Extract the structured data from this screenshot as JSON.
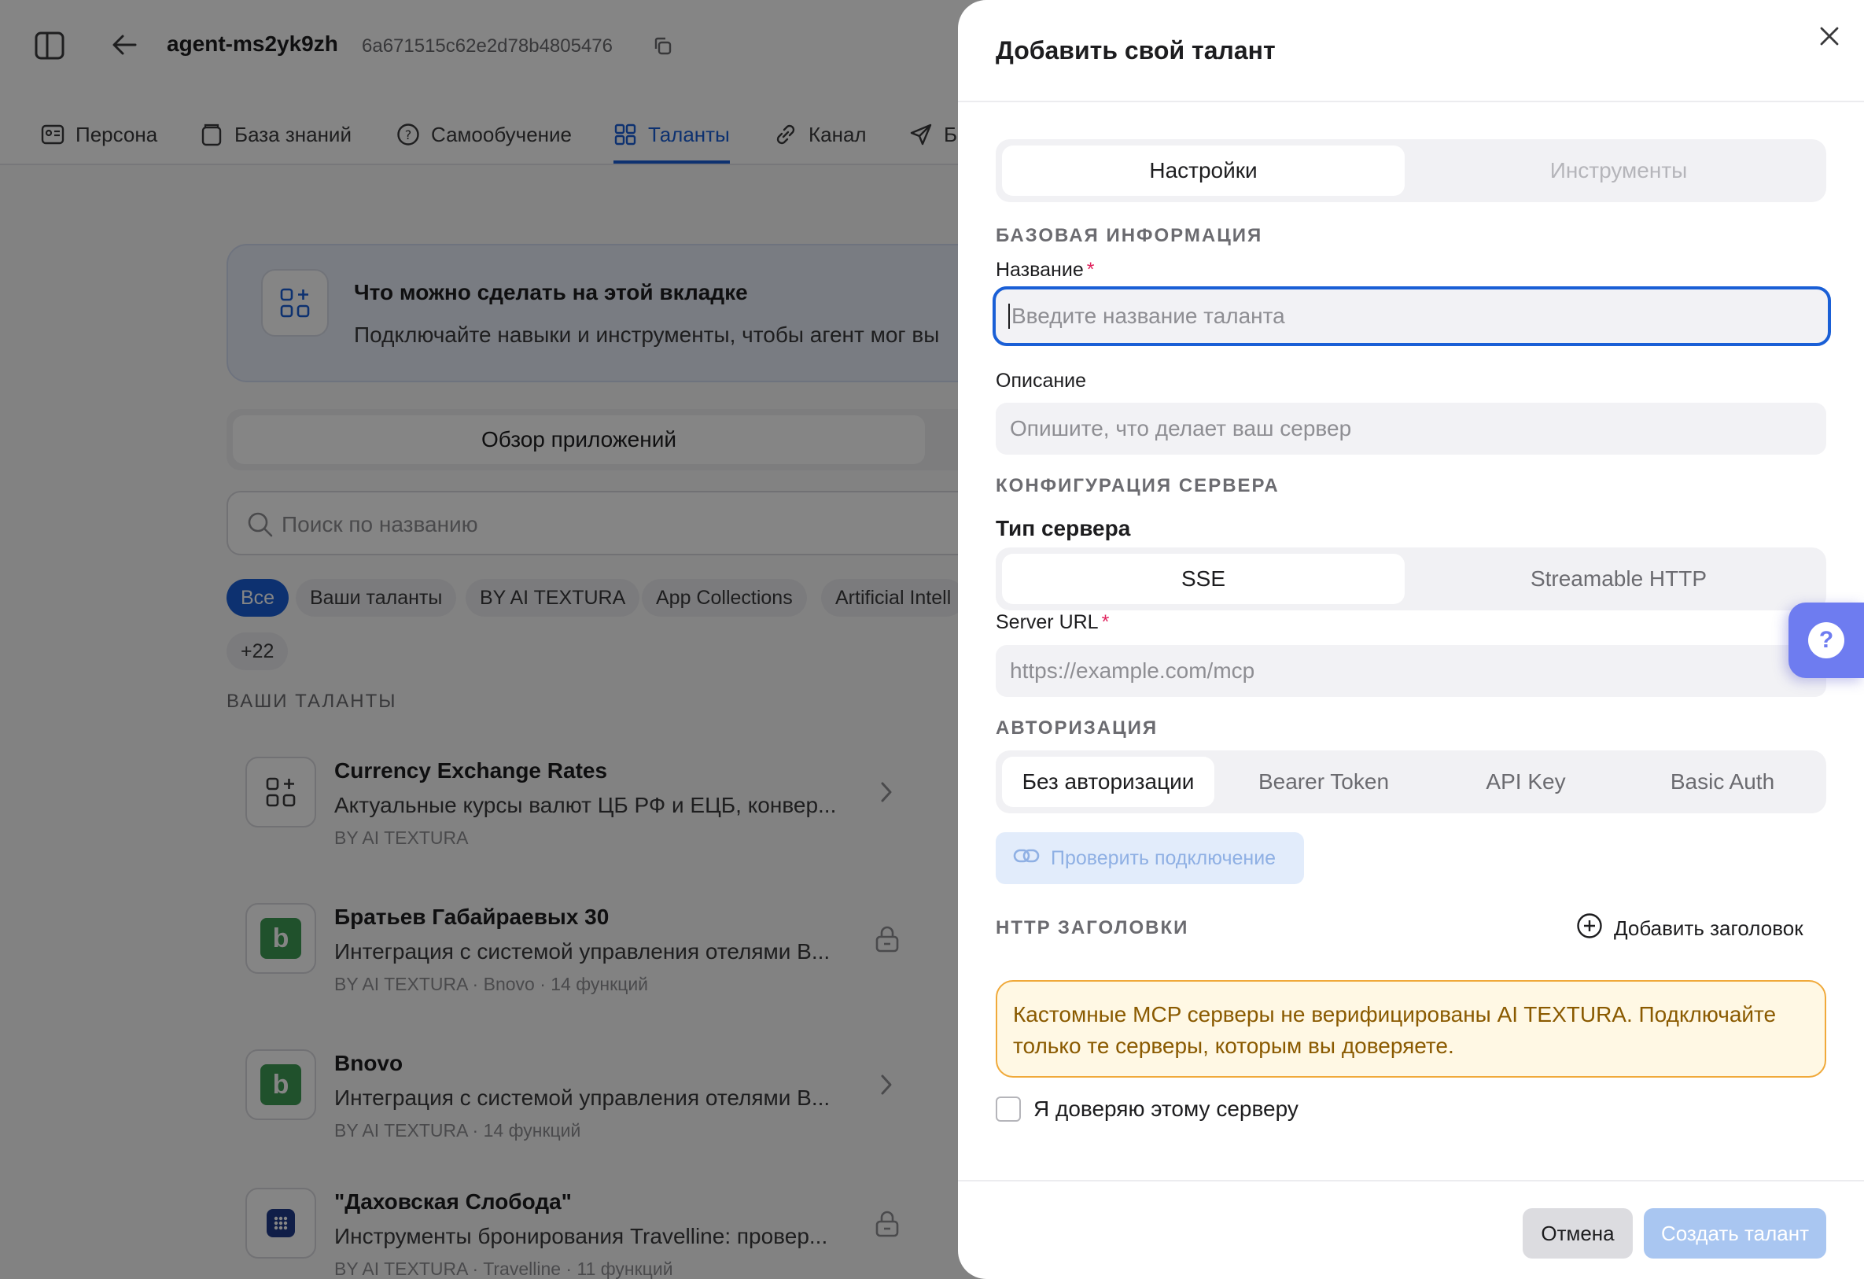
{
  "topbar": {
    "agent_name": "agent-ms2yk9zh",
    "agent_id": "6a671515c62e2d78b4805476"
  },
  "tabs": [
    {
      "label": "Персона",
      "icon": "persona-icon"
    },
    {
      "label": "База знаний",
      "icon": "database-icon"
    },
    {
      "label": "Самообучение",
      "icon": "question-circle-icon"
    },
    {
      "label": "Таланты",
      "icon": "grid-icon",
      "active": true
    },
    {
      "label": "Канал",
      "icon": "link-icon"
    },
    {
      "label": "Б",
      "icon": "send-icon"
    }
  ],
  "info_card": {
    "title": "Что можно сделать на этой вкладке",
    "text": "Подключайте навыки и инструменты, чтобы агент мог вы"
  },
  "segment": {
    "active_label": "Обзор приложений"
  },
  "search": {
    "placeholder": "Поиск по названию"
  },
  "chips": [
    "Все",
    "Ваши таланты",
    "BY AI TEXTURA",
    "App Collections",
    "Artificial Intell",
    "+22"
  ],
  "section_label": "ВАШИ ТАЛАНТЫ",
  "talents": [
    {
      "title": "Currency Exchange Rates",
      "desc": "Актуальные курсы валют ЦБ РФ и ЕЦБ, конвер...",
      "meta": "BY AI TEXTURA",
      "icon": "grid-plus-icon",
      "side": "chevron-right-icon"
    },
    {
      "title": "Братьев Габайраевых 30",
      "desc": "Интеграция с системой управления отелями B...",
      "meta": "BY AI TEXTURA · Bnovo · 14 функций",
      "icon": "bnovo-logo",
      "side": "lock-icon"
    },
    {
      "title": "Bnovo",
      "desc": "Интеграция с системой управления отелями B...",
      "meta": "BY AI TEXTURA · 14 функций",
      "icon": "bnovo-logo",
      "side": "chevron-right-icon"
    },
    {
      "title": "\"Даховская Слобода\"",
      "desc": "Инструменты бронирования Travelline: провер...",
      "meta": "BY AI TEXTURA · Travelline · 11 функций",
      "icon": "travelline-logo",
      "side": "lock-icon"
    }
  ],
  "drawer": {
    "title": "Добавить свой талант",
    "tabs": {
      "settings": "Настройки",
      "tools": "Инструменты"
    },
    "basic_info_caption": "БАЗОВАЯ ИНФОРМАЦИЯ",
    "name_label": "Название",
    "name_placeholder": "Введите название таланта",
    "desc_label": "Описание",
    "desc_placeholder": "Опишите, что делает ваш сервер",
    "server_config_caption": "КОНФИГУРАЦИЯ СЕРВЕРА",
    "server_type_label": "Тип сервера",
    "server_types": [
      "SSE",
      "Streamable HTTP"
    ],
    "server_url_label": "Server URL",
    "server_url_placeholder": "https://example.com/mcp",
    "auth_caption": "АВТОРИЗАЦИЯ",
    "auth_options": [
      "Без авторизации",
      "Bearer Token",
      "API Key",
      "Basic Auth"
    ],
    "check_connection": "Проверить подключение",
    "http_headers_caption": "HTTP ЗАГОЛОВКИ",
    "add_header": "Добавить заголовок",
    "warning": "Кастомные MCP серверы не верифицированы AI TEXTURA. Подключайте только те серверы, которым вы доверяете.",
    "trust_label": "Я доверяю этому серверу",
    "cancel": "Отмена",
    "create": "Создать талант"
  },
  "help": {
    "label": "?"
  },
  "colors": {
    "accent": "#1a5fd6",
    "warning_border": "#f0a93a",
    "warning_bg": "#fff8e4",
    "help": "#6e7cf0"
  }
}
